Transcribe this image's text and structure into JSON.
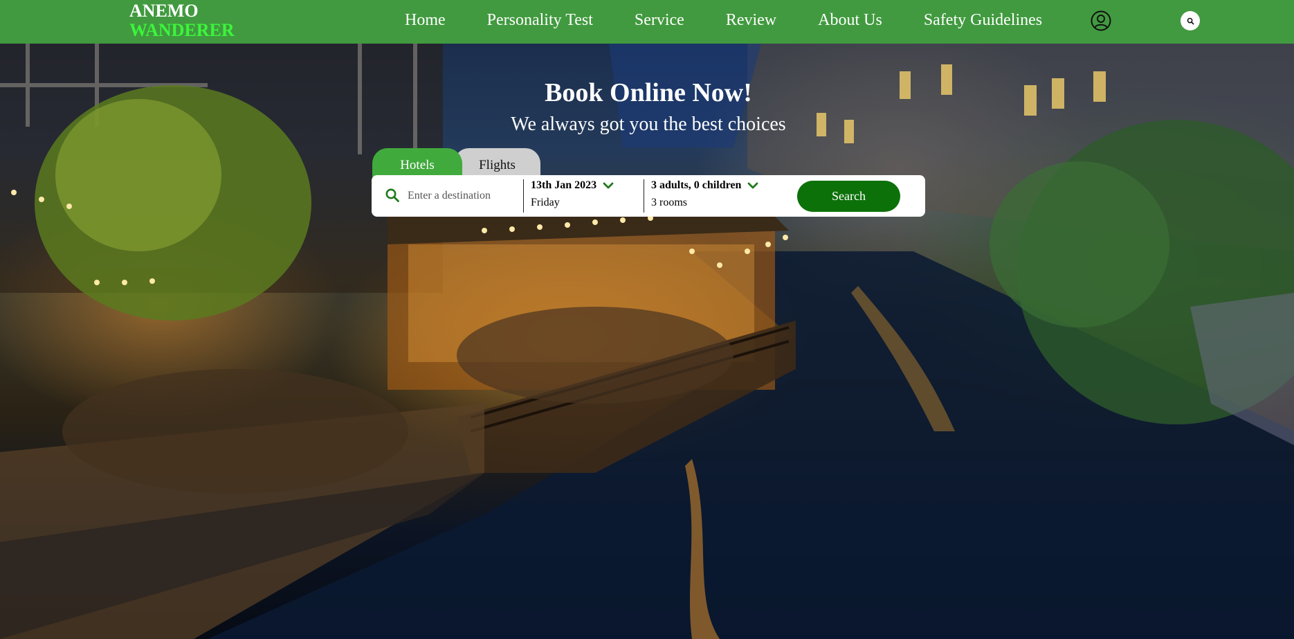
{
  "brand": {
    "line1": "ANEMO",
    "line2": "WANDERER",
    "colors": {
      "line1": "#ffffff",
      "line2": "#3cf53c",
      "navbar": "#419a3f"
    }
  },
  "nav": {
    "links": [
      "Home",
      "Personality Test",
      "Service",
      "Review",
      "About Us",
      "Safety Guidelines"
    ],
    "icons": {
      "account": "user-circle-icon",
      "search": "search-icon"
    }
  },
  "hero": {
    "title": "Book Online Now!",
    "subtitle": "We always got you the best choices",
    "background": "night-canal-restaurant-photo"
  },
  "booking": {
    "tabs": [
      {
        "label": "Hotels",
        "active": true
      },
      {
        "label": "Flights",
        "active": false
      }
    ],
    "destination": {
      "placeholder": "Enter a destination",
      "value": "",
      "icon": "search-icon"
    },
    "date": {
      "value": "13th Jan 2023",
      "day": "Friday",
      "icon": "chevron-down-icon"
    },
    "guests": {
      "value": "3 adults, 0 children",
      "rooms": "3 rooms",
      "icon": "chevron-down-icon"
    },
    "search_label": "Search",
    "colors": {
      "active_tab": "#41aa3d",
      "inactive_tab": "#cfcfcf",
      "search_button": "#0d710a",
      "icon_green": "#1f7a1d"
    }
  }
}
